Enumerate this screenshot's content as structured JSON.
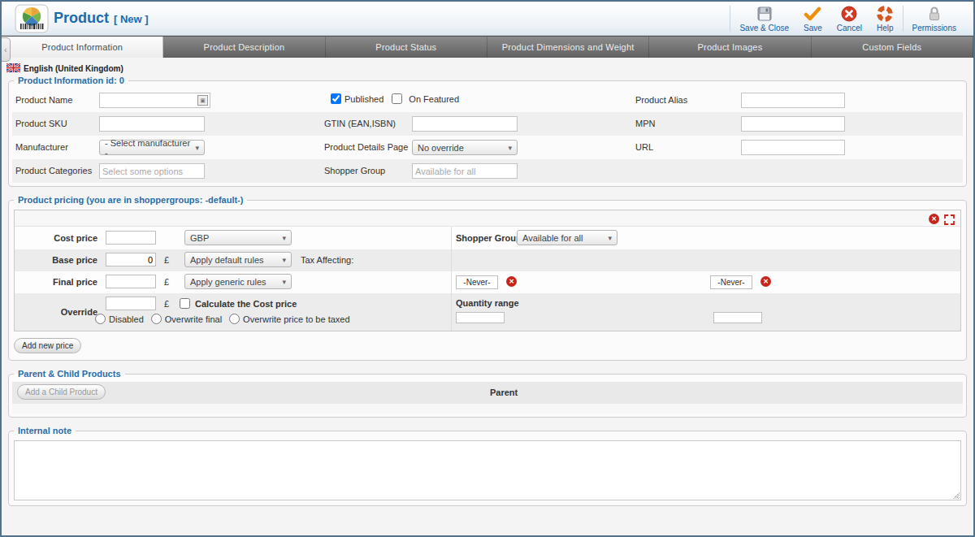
{
  "window": {
    "title": "Product",
    "title_suffix": "[ New ]"
  },
  "toolbar": {
    "save_close_label": "Save & Close",
    "save_label": "Save",
    "cancel_label": "Cancel",
    "help_label": "Help",
    "permissions_label": "Permissions"
  },
  "tabs": [
    {
      "label": "Product Information",
      "active": true
    },
    {
      "label": "Product Description",
      "active": false
    },
    {
      "label": "Product Status",
      "active": false
    },
    {
      "label": "Product Dimensions and Weight",
      "active": false
    },
    {
      "label": "Product Images",
      "active": false
    },
    {
      "label": "Custom Fields",
      "active": false
    }
  ],
  "language": {
    "label": "English (United Kingdom)"
  },
  "icons": {
    "handle_glyph": "‹",
    "delete_glyph": "✕",
    "check_glyph": "✔",
    "cancel_glyph": "✕"
  },
  "colors": {
    "accent_blue": "#1a6cb1",
    "legend_blue": "#2a6da8",
    "danger_red": "#c6251c",
    "save_orange": "#ef8f0e",
    "help_orange": "#d4581f"
  },
  "info": {
    "legend": "Product Information id: 0",
    "product_name_label": "Product Name",
    "product_name_value": "",
    "published_label": "Published",
    "published_checked": "checked",
    "on_featured_label": "On Featured",
    "product_alias_label": "Product Alias",
    "product_sku_label": "Product SKU",
    "gtin_label": "GTIN (EAN,ISBN)",
    "mpn_label": "MPN",
    "manufacturer_label": "Manufacturer",
    "manufacturer_value": "- Select manufacturer -",
    "details_page_label": "Product Details Page",
    "details_page_value": "No override",
    "url_label": "URL",
    "categories_label": "Product Categories",
    "categories_placeholder": "Select some options",
    "shopper_group_label": "Shopper Group",
    "shopper_group_placeholder": "Available for all"
  },
  "pricing": {
    "legend": "Product pricing (you are in shoppergroups: -default-)",
    "cost_price_label": "Cost price",
    "cost_currency": "GBP",
    "base_price_label": "Base price",
    "base_price_value": "0",
    "currency_symbol": "£",
    "base_rule": "Apply default rules",
    "tax_label": "Tax Affecting:",
    "final_price_label": "Final price",
    "final_rule": "Apply generic rules",
    "override_label": "Override",
    "calc_cost_label": "Calculate the Cost price",
    "override_options": {
      "0": "Disabled",
      "1": "Overwrite final",
      "2": "Overwrite price to be taxed"
    },
    "shopper_group_label": "Shopper Group",
    "shopper_group_value": "Available for all",
    "date_start": "-Never-",
    "date_end": "-Never-",
    "quantity_label": "Quantity range",
    "add_button": "Add new price"
  },
  "parent_child": {
    "legend": "Parent & Child Products",
    "add_button": "Add a Child Product",
    "parent_label": "Parent"
  },
  "internal_note": {
    "legend": "Internal note",
    "value": ""
  }
}
